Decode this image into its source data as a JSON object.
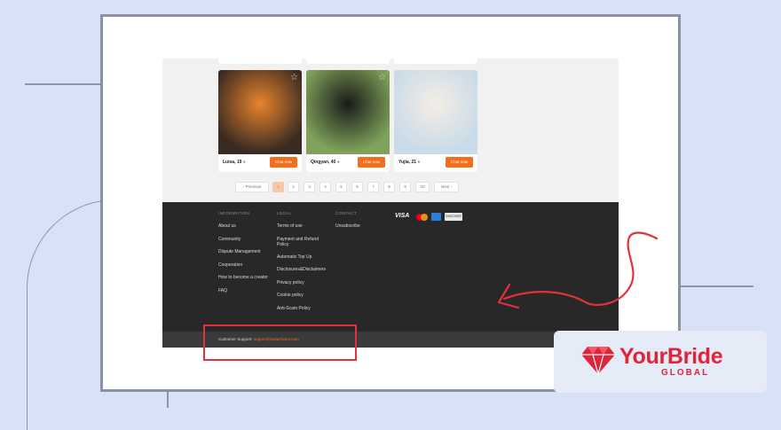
{
  "profiles": [
    {
      "name": "Luisa, 19",
      "photos": "12",
      "chat_label": "Chat now",
      "bg1": "#3a2b22",
      "bg2": "#e9832c"
    },
    {
      "name": "Qingyan, 40",
      "photos": "6",
      "chat_label": "Chat now",
      "bg1": "#7fa35a",
      "bg2": "#1a1a1a"
    },
    {
      "name": "Yujia, 21",
      "photos": "6",
      "chat_label": "Chat now",
      "bg1": "#c9dbe8",
      "bg2": "#f4ede6"
    }
  ],
  "pagination": {
    "previous": "‹ Previous",
    "pages": [
      "1",
      "2",
      "3",
      "4",
      "5",
      "6",
      "7",
      "8",
      "9",
      "10"
    ],
    "active": "1",
    "next": "Next ›"
  },
  "footer": {
    "information": {
      "heading": "INFORMATION",
      "items": [
        "About us",
        "Community",
        "Dispute Management",
        "Cooperation",
        "How to become a creator",
        "FAQ"
      ]
    },
    "legal": {
      "heading": "LEGAL",
      "items": [
        "Terms of use",
        "Payment and Refund Policy",
        "Automatic Top Up",
        "Disclosures&Disclaimers",
        "Privacy policy",
        "Cookie policy",
        "Anti-Scam Policy"
      ]
    },
    "contact": {
      "heading": "CONTACT",
      "items": [
        "Unsubscribe"
      ]
    },
    "payments": {
      "visa": "VISA",
      "discover": "DISCOVER"
    },
    "support_label": "Customer Support:",
    "support_email": "support@asiacharm.com"
  },
  "brand": {
    "name": "YourBride",
    "tagline": "GLOBAL",
    "color": "#e0253a"
  },
  "colors": {
    "accent": "#f26e1a",
    "footer_bg": "#282828",
    "highlight": "#e3303a"
  }
}
